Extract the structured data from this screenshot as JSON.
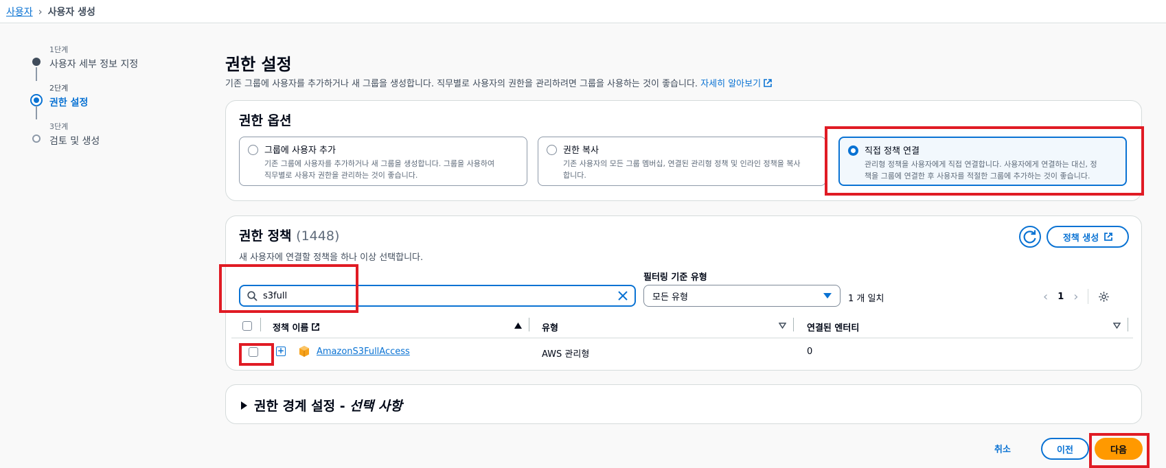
{
  "breadcrumb": {
    "parent": "사용자",
    "current": "사용자 생성"
  },
  "steps": [
    {
      "num": "1단계",
      "label": "사용자 세부 정보 지정"
    },
    {
      "num": "2단계",
      "label": "권한 설정"
    },
    {
      "num": "3단계",
      "label": "검토 및 생성"
    }
  ],
  "page": {
    "title": "권한 설정",
    "desc": "기존 그룹에 사용자를 추가하거나 새 그룹을 생성합니다. 직무별로 사용자의 권한을 관리하려면 그룹을 사용하는 것이 좋습니다.",
    "learn_more": "자세히 알아보기"
  },
  "options": {
    "title": "권한 옵션",
    "items": [
      {
        "title": "그룹에 사용자 추가",
        "desc1": "기존 그룹에 사용자를 추가하거나 새 그룹을 생성합니다. 그룹을 사용하여",
        "desc2": "직무별로 사용자 권한을 관리하는 것이 좋습니다."
      },
      {
        "title": "권한 복사",
        "desc1": "기존 사용자의 모든 그룹 멤버십, 연결된 관리형 정책 및 인라인 정책을 복사",
        "desc2": "합니다."
      },
      {
        "title": "직접 정책 연결",
        "desc1": "관리형 정책을 사용자에게 직접 연결합니다. 사용자에게 연결하는 대신, 정",
        "desc2": "책을 그룹에 연결한 후 사용자를 적절한 그룹에 추가하는 것이 좋습니다."
      }
    ],
    "selected_index": 2
  },
  "policies": {
    "title": "권한 정책",
    "count": "(1448)",
    "desc": "새 사용자에 연결할 정책을 하나 이상 선택합니다.",
    "create_label": "정책 생성",
    "search_value": "s3full",
    "filter_label": "필터링 기준 유형",
    "filter_value": "모든 유형",
    "match_text": "1 개 일치",
    "page": "1",
    "columns": {
      "name": "정책 이름",
      "type": "유형",
      "entities": "연결된 엔터티"
    },
    "rows": [
      {
        "name": "AmazonS3FullAccess",
        "type": "AWS 관리형",
        "entities": "0"
      }
    ]
  },
  "boundary": {
    "title": "권한 경계 설정 - ",
    "optional": "선택 사항"
  },
  "footer": {
    "cancel": "취소",
    "prev": "이전",
    "next": "다음"
  },
  "colors": {
    "accent": "#0972d3",
    "primary_button": "#ff9900",
    "highlight": "#e01b24"
  }
}
